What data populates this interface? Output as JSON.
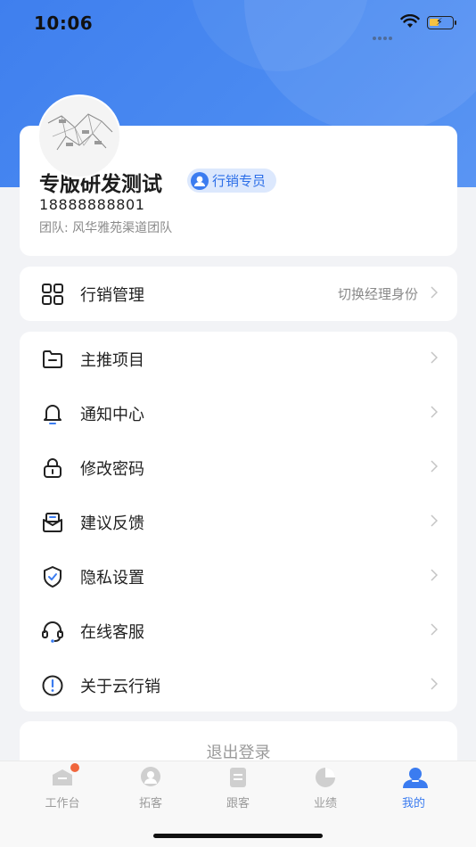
{
  "status_bar": {
    "time": "10:06"
  },
  "profile": {
    "name": "专版研发测试",
    "role": "行销专员",
    "phone": "18888888801",
    "team": "团队: 风华雅苑渠道团队"
  },
  "marketing": {
    "label": "行销管理",
    "action": "切换经理身份"
  },
  "menu": [
    {
      "label": "主推项目",
      "icon": "folder-icon"
    },
    {
      "label": "通知中心",
      "icon": "bell-icon"
    },
    {
      "label": "修改密码",
      "icon": "lock-icon"
    },
    {
      "label": "建议反馈",
      "icon": "mail-icon"
    },
    {
      "label": "隐私设置",
      "icon": "shield-icon"
    },
    {
      "label": "在线客服",
      "icon": "headset-icon"
    },
    {
      "label": "关于云行销",
      "icon": "info-icon"
    }
  ],
  "logout": "退出登录",
  "tabs": [
    {
      "label": "工作台",
      "icon": "workbench-icon"
    },
    {
      "label": "拓客",
      "icon": "expand-customer-icon"
    },
    {
      "label": "跟客",
      "icon": "follow-customer-icon"
    },
    {
      "label": "业绩",
      "icon": "performance-icon"
    },
    {
      "label": "我的",
      "icon": "me-icon"
    }
  ],
  "colors": {
    "brand": "#3b7cf0",
    "badge_bg": "#dce8fd",
    "notification_dot": "#f0663d"
  }
}
